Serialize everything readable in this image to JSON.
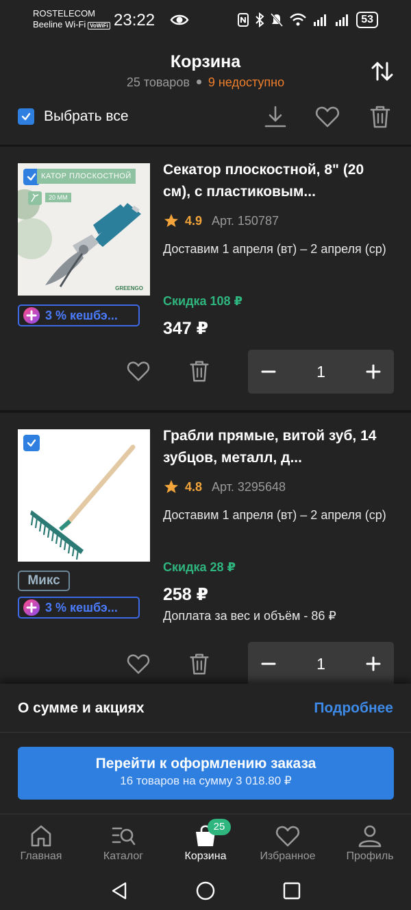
{
  "status_bar": {
    "carrier_1": "ROSTELECOM",
    "carrier_2": "Beeline Wi-Fi",
    "vowifi": "VoWiFi",
    "time": "23:22",
    "battery": "53"
  },
  "header": {
    "title": "Корзина",
    "items_count": "25 товаров",
    "unavailable": "9 недоступно",
    "select_all_label": "Выбрать все"
  },
  "items": [
    {
      "image_banner": "КАТОР ПЛОСКОСТНОЙ",
      "image_tag": "20 ММ",
      "image_brand": "GREENGO",
      "cashback": "3 % кешбэ...",
      "title": "Секатор плоскостной, 8\" (20 см), с пластиковым...",
      "rating": "4.9",
      "article": "Арт. 150787",
      "delivery": "Доставим 1 апреля (вт) – 2 апреля (ср)",
      "discount": "Скидка 108 ₽",
      "price": "347 ₽",
      "quantity": "1"
    },
    {
      "badge": "Микс",
      "cashback": "3 % кешбэ...",
      "title": "Грабли прямые, витой зуб, 14 зубцов, металл, д...",
      "rating": "4.8",
      "article": "Арт. 3295648",
      "delivery": "Доставим 1 апреля (вт) – 2 апреля (ср)",
      "discount": "Скидка 28 ₽",
      "price": "258 ₽",
      "surcharge": "Доплата за вес и объём - 86 ₽",
      "quantity": "1"
    }
  ],
  "summary": {
    "label": "О сумме и акциях",
    "link": "Подробнее"
  },
  "checkout": {
    "main": "Перейти к оформлению заказа",
    "sub": "16 товаров на сумму 3 018.80 ₽"
  },
  "bottom_nav": [
    {
      "label": "Главная",
      "icon": "home-icon"
    },
    {
      "label": "Каталог",
      "icon": "catalog-icon"
    },
    {
      "label": "Корзина",
      "icon": "cart-icon",
      "badge": "25"
    },
    {
      "label": "Избранное",
      "icon": "heart-icon"
    },
    {
      "label": "Профиль",
      "icon": "profile-icon"
    }
  ],
  "colors": {
    "background": "#232323",
    "accent": "#2f7fe0",
    "discount": "#2fb57e",
    "warning": "#f07f2c",
    "rating": "#f3a43a",
    "cashback": "#3b69e8"
  }
}
